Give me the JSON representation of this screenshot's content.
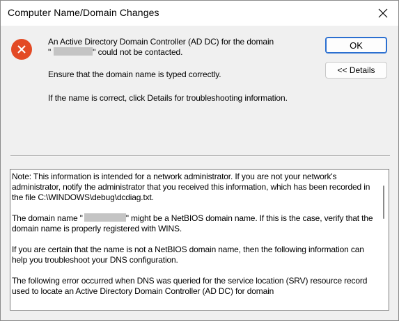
{
  "window": {
    "title": "Computer Name/Domain Changes",
    "close_icon": "close-icon"
  },
  "message": {
    "line1_prefix": "An Active Directory Domain Controller (AD DC) for the domain",
    "line1_quote_open": "\"",
    "line1_suffix": "\" could not be contacted.",
    "line2": "Ensure that the domain name is typed correctly.",
    "line3": "If the name is correct, click Details for troubleshooting information.",
    "icon": "error-icon",
    "icon_color": "#e34a25"
  },
  "buttons": {
    "ok_label": "OK",
    "details_label": "<< Details"
  },
  "details": {
    "para1": "Note: This information is intended for a network administrator.  If you are not your network's administrator, notify the administrator that you received this information, which has been recorded in the file C:\\WINDOWS\\debug\\dcdiag.txt.",
    "para2_prefix": "The domain name \"",
    "para2_suffix": "\" might be a NetBIOS domain name.  If this is the case, verify that the domain name is properly registered with WINS.",
    "para3": "If you are certain that the name is not a NetBIOS domain name, then the following information can help you troubleshoot your DNS configuration.",
    "para4": "The following error occurred when DNS was queried for the service location (SRV) resource record used to locate an Active Directory Domain Controller (AD DC) for domain"
  }
}
